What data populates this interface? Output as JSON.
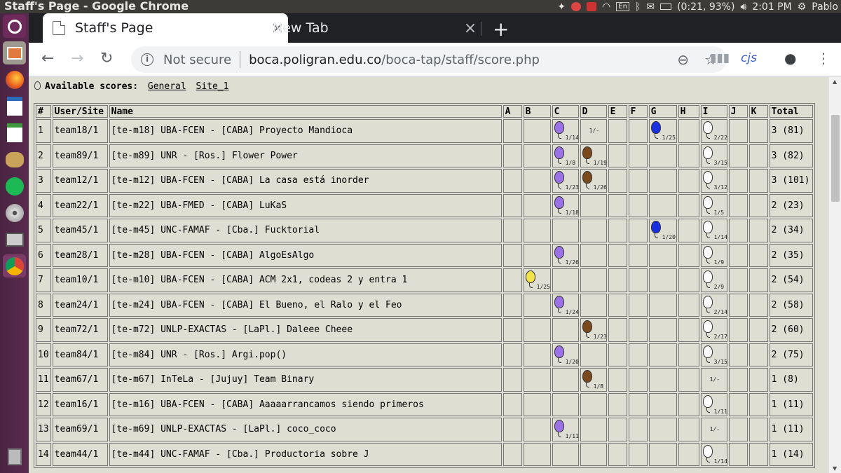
{
  "os_panel": {
    "window_title": "Staff's Page - Google Chrome",
    "battery": "(0:21, 93%)",
    "time": "2:01 PM",
    "user": "Pablo",
    "lang": "En"
  },
  "launcher": {
    "items": [
      "ubuntu-logo-icon",
      "files-icon",
      "firefox-icon",
      "writer-icon",
      "calc-icon",
      "gimp-icon",
      "spotify-icon",
      "disc-icon",
      "printer-icon",
      "chrome-icon",
      "trash-icon"
    ]
  },
  "tabs": [
    {
      "label": "Staff's Page"
    },
    {
      "label": "New Tab"
    }
  ],
  "address": {
    "security": "Not secure",
    "host": "boca.poligran.edu.co",
    "path": "/boca-tap/staff/score.php"
  },
  "extensions": {
    "cjs": "cjs"
  },
  "page": {
    "available_label": "Available scores:",
    "links": [
      "General",
      "Site_1"
    ]
  },
  "colors": {
    "balloon_purple": "#9b72e6",
    "balloon_brown": "#7a4a1e",
    "balloon_blue": "#1a2fe0",
    "balloon_yellow": "#f0e34a",
    "balloon_white": "#ffffff",
    "page_bg": "#deded2"
  },
  "table": {
    "headers": [
      "#",
      "User/Site",
      "Name",
      "A",
      "B",
      "C",
      "D",
      "E",
      "F",
      "G",
      "H",
      "I",
      "J",
      "K",
      "Total"
    ],
    "rows": [
      {
        "rank": "1",
        "user": "team18/1",
        "name": "[te-m18] UBA-FCEN - [CABA] Proyecto Mandioca",
        "cells": {
          "C": {
            "b": "purple",
            "t": "1/14"
          },
          "D": {
            "t": "1/-"
          },
          "G": {
            "b": "blue",
            "t": "1/25"
          },
          "I": {
            "b": "white",
            "t": "2/22"
          }
        },
        "total": "3 (81)"
      },
      {
        "rank": "2",
        "user": "team89/1",
        "name": "[te-m89] UNR - [Ros.] Flower Power",
        "cells": {
          "C": {
            "b": "purple",
            "t": "1/8"
          },
          "D": {
            "b": "brown",
            "t": "1/19"
          },
          "I": {
            "b": "white",
            "t": "3/15"
          }
        },
        "total": "3 (82)"
      },
      {
        "rank": "3",
        "user": "team12/1",
        "name": "[te-m12] UBA-FCEN - [CABA] La casa está inorder",
        "cells": {
          "C": {
            "b": "purple",
            "t": "1/23"
          },
          "D": {
            "b": "brown",
            "t": "1/26"
          },
          "I": {
            "b": "white",
            "t": "3/12"
          }
        },
        "total": "3 (101)"
      },
      {
        "rank": "4",
        "user": "team22/1",
        "name": "[te-m22] UBA-FMED - [CABA] LuKaS",
        "cells": {
          "C": {
            "b": "purple",
            "t": "1/18"
          },
          "I": {
            "b": "white",
            "t": "1/5"
          }
        },
        "total": "2 (23)"
      },
      {
        "rank": "5",
        "user": "team45/1",
        "name": "[te-m45] UNC-FAMAF - [Cba.] Fucktorial",
        "cells": {
          "G": {
            "b": "blue",
            "t": "1/20"
          },
          "I": {
            "b": "white",
            "t": "1/14"
          }
        },
        "total": "2 (34)"
      },
      {
        "rank": "6",
        "user": "team28/1",
        "name": "[te-m28] UBA-FCEN - [CABA] AlgoEsAlgo",
        "cells": {
          "C": {
            "b": "purple",
            "t": "1/26"
          },
          "I": {
            "b": "white",
            "t": "1/9"
          }
        },
        "total": "2 (35)"
      },
      {
        "rank": "7",
        "user": "team10/1",
        "name": "[te-m10] UBA-FCEN - [CABA] ACM 2x1, codeas 2 y entra 1",
        "cells": {
          "B": {
            "b": "yellow",
            "t": "1/25"
          },
          "I": {
            "b": "white",
            "t": "2/9"
          }
        },
        "total": "2 (54)"
      },
      {
        "rank": "8",
        "user": "team24/1",
        "name": "[te-m24] UBA-FCEN - [CABA] El Bueno, el Ralo y el Feo",
        "cells": {
          "C": {
            "b": "purple",
            "t": "1/24"
          },
          "I": {
            "b": "white",
            "t": "2/14"
          }
        },
        "total": "2 (58)"
      },
      {
        "rank": "9",
        "user": "team72/1",
        "name": "[te-m72] UNLP-EXACTAS - [LaPl.] Daleee Cheee",
        "cells": {
          "D": {
            "b": "brown",
            "t": "1/23"
          },
          "I": {
            "b": "white",
            "t": "2/17"
          }
        },
        "total": "2 (60)"
      },
      {
        "rank": "10",
        "user": "team84/1",
        "name": "[te-m84] UNR - [Ros.] Argi.pop()",
        "cells": {
          "C": {
            "b": "purple",
            "t": "1/20"
          },
          "I": {
            "b": "white",
            "t": "3/15"
          }
        },
        "total": "2 (75)"
      },
      {
        "rank": "11",
        "user": "team67/1",
        "name": "[te-m67] InTeLa - [Jujuy] Team Binary",
        "cells": {
          "D": {
            "b": "brown",
            "t": "1/8"
          },
          "I": {
            "t": "1/-"
          }
        },
        "total": "1 (8)"
      },
      {
        "rank": "12",
        "user": "team16/1",
        "name": "[te-m16] UBA-FCEN - [CABA] Aaaaarrancamos siendo primeros",
        "cells": {
          "I": {
            "b": "white",
            "t": "1/11"
          }
        },
        "total": "1 (11)"
      },
      {
        "rank": "13",
        "user": "team69/1",
        "name": "[te-m69] UNLP-EXACTAS - [LaPl.] coco_coco",
        "cells": {
          "C": {
            "b": "purple",
            "t": "1/11"
          },
          "I": {
            "t": "1/-"
          }
        },
        "total": "1 (11)"
      },
      {
        "rank": "14",
        "user": "team44/1",
        "name": "[te-m44] UNC-FAMAF - [Cba.] Productoria sobre J",
        "cells": {
          "I": {
            "b": "white",
            "t": "1/14"
          }
        },
        "total": "1 (14)"
      }
    ]
  }
}
